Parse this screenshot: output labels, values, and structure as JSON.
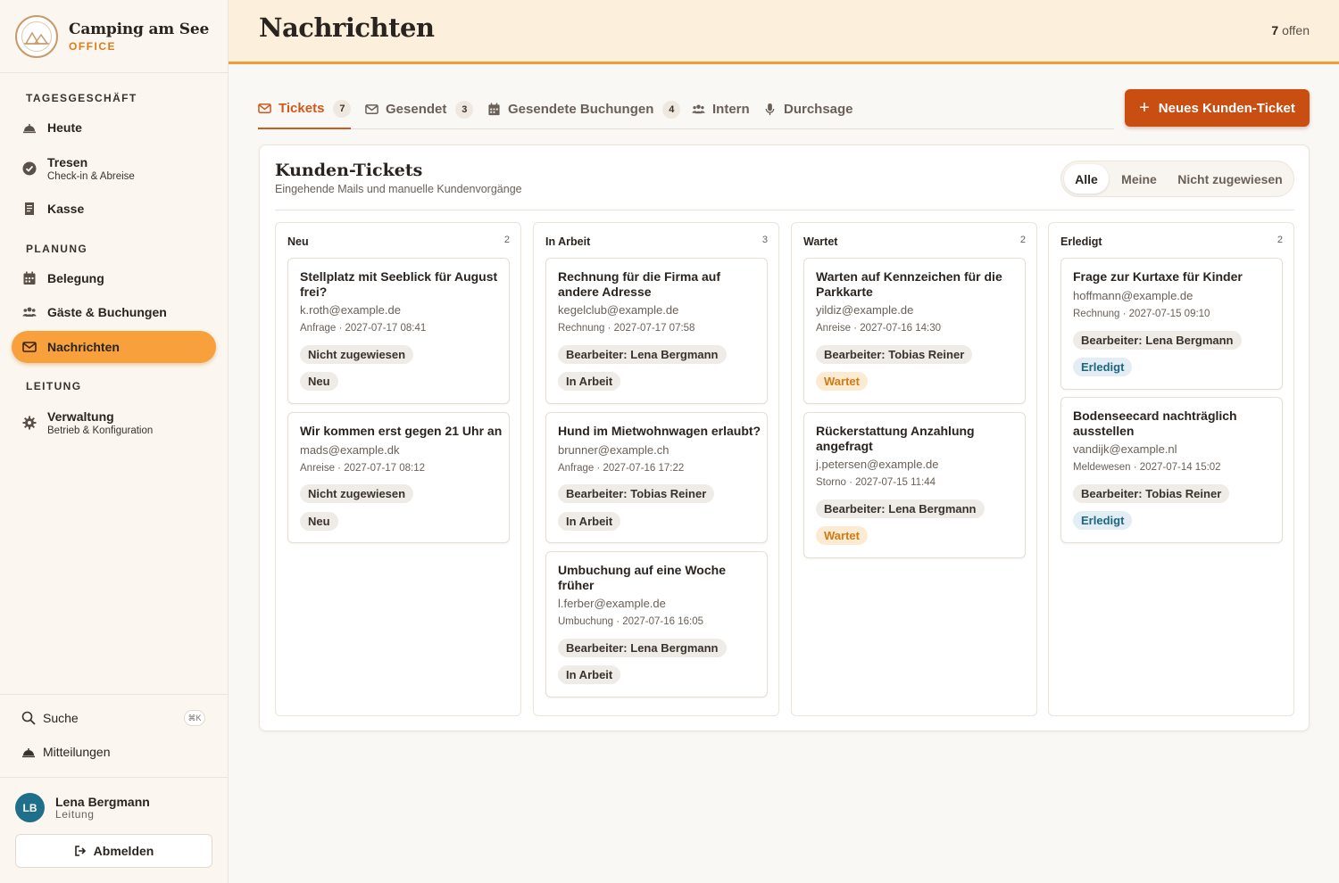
{
  "brand": {
    "title": "Camping am See",
    "subtitle": "OFFICE"
  },
  "sidebar": {
    "sections": [
      "TAGESGESCHÄFT",
      "PLANUNG",
      "LEITUNG"
    ],
    "items": [
      {
        "label": "Heute",
        "icon": "bell-icon"
      },
      {
        "label": "Tresen",
        "sub": "Check-in & Abreise",
        "icon": "check-circle-icon"
      },
      {
        "label": "Kasse",
        "icon": "receipt-icon"
      },
      {
        "label": "Belegung",
        "icon": "calendar-icon"
      },
      {
        "label": "Gäste & Buchungen",
        "icon": "users-icon"
      },
      {
        "label": "Nachrichten",
        "icon": "mail-icon",
        "active": true
      },
      {
        "label": "Verwaltung",
        "sub": "Betrieb & Konfiguration",
        "icon": "gear-icon"
      }
    ],
    "search_label": "Suche",
    "search_shortcut": "⌘K",
    "notifications_label": "Mitteilungen",
    "user": {
      "initials": "LB",
      "name": "Lena Bergmann",
      "role": "Leitung"
    },
    "logout_label": "Abmelden"
  },
  "header": {
    "title": "Nachrichten",
    "open_count": "7",
    "open_label": "offen"
  },
  "tabs": [
    {
      "label": "Tickets",
      "badge": "7",
      "icon": "mail-icon",
      "active": true
    },
    {
      "label": "Gesendet",
      "badge": "3",
      "icon": "mail-icon"
    },
    {
      "label": "Gesendete Buchungen",
      "badge": "4",
      "icon": "calendar-icon"
    },
    {
      "label": "Intern",
      "icon": "users-icon"
    },
    {
      "label": "Durchsage",
      "icon": "microphone-icon"
    }
  ],
  "new_ticket_label": "Neues Kunden-Ticket",
  "panel": {
    "title": "Kunden-Tickets",
    "subtitle": "Eingehende Mails und manuelle Kundenvorgänge",
    "filters": [
      "Alle",
      "Meine",
      "Nicht zugewiesen"
    ],
    "active_filter": "Alle"
  },
  "columns": [
    {
      "title": "Neu",
      "count": "2",
      "cards": [
        {
          "title": "Stellplatz mit Seeblick für August frei?",
          "email": "k.roth@example.de",
          "meta": "Anfrage · 2027-07-17 08:41",
          "assignee": "Nicht zugewiesen",
          "status": "Neu"
        },
        {
          "title": "Wir kommen erst gegen 21 Uhr an",
          "email": "mads@example.dk",
          "meta": "Anreise · 2027-07-17 08:12",
          "assignee": "Nicht zugewiesen",
          "status": "Neu"
        }
      ]
    },
    {
      "title": "In Arbeit",
      "count": "3",
      "cards": [
        {
          "title": "Rechnung für die Firma auf andere Adresse",
          "email": "kegelclub@example.de",
          "meta": "Rechnung · 2027-07-17 07:58",
          "assignee": "Bearbeiter: Lena Bergmann",
          "status": "In Arbeit"
        },
        {
          "title": "Hund im Mietwohnwagen erlaubt?",
          "email": "brunner@example.ch",
          "meta": "Anfrage · 2027-07-16 17:22",
          "assignee": "Bearbeiter: Tobias Reiner",
          "status": "In Arbeit"
        },
        {
          "title": "Umbuchung auf eine Woche früher",
          "email": "l.ferber@example.de",
          "meta": "Umbuchung · 2027-07-16 16:05",
          "assignee": "Bearbeiter: Lena Bergmann",
          "status": "In Arbeit"
        }
      ]
    },
    {
      "title": "Wartet",
      "count": "2",
      "cards": [
        {
          "title": "Warten auf Kennzeichen für die Parkkarte",
          "email": "yildiz@example.de",
          "meta": "Anreise · 2027-07-16 14:30",
          "assignee": "Bearbeiter: Tobias Reiner",
          "status": "Wartet"
        },
        {
          "title": "Rückerstattung Anzahlung angefragt",
          "email": "j.petersen@example.de",
          "meta": "Storno · 2027-07-15 11:44",
          "assignee": "Bearbeiter: Lena Bergmann",
          "status": "Wartet"
        }
      ]
    },
    {
      "title": "Erledigt",
      "count": "2",
      "cards": [
        {
          "title": "Frage zur Kurtaxe für Kinder",
          "email": "hoffmann@example.de",
          "meta": "Rechnung · 2027-07-15 09:10",
          "assignee": "Bearbeiter: Lena Bergmann",
          "status": "Erledigt"
        },
        {
          "title": "Bodenseecard nachträglich ausstellen",
          "email": "vandijk@example.nl",
          "meta": "Meldewesen · 2027-07-14 15:02",
          "assignee": "Bearbeiter: Tobias Reiner",
          "status": "Erledigt"
        }
      ]
    }
  ],
  "colors": {
    "accent": "#d0581a",
    "button": "#c94e12",
    "nav_active": "#f7a03c",
    "header_bg": "#fcefdb",
    "wait": "#d07a14",
    "done": "#1e6580"
  }
}
